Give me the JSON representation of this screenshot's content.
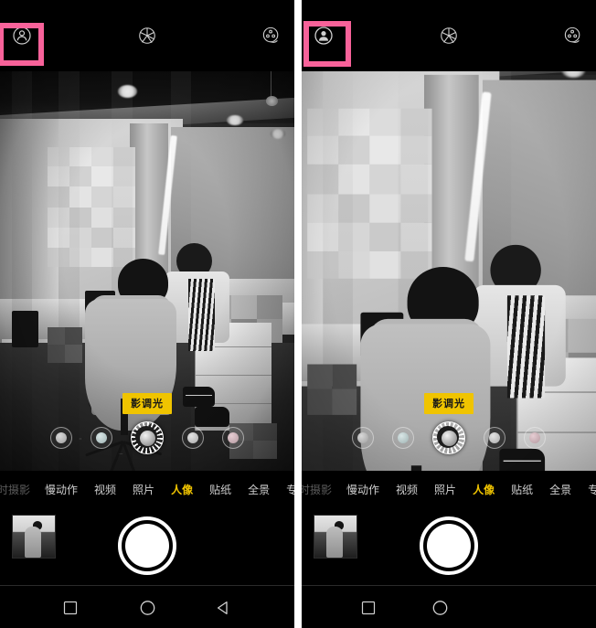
{
  "screenshot": {
    "title": "Camera app portrait-mode comparison",
    "panel_count": 2
  },
  "highlight": {
    "color": "#f8629a",
    "target": "beauty-portrait-toggle"
  },
  "topbar": {
    "left_icon": "portrait-person-icon",
    "mid_icon": "aperture-icon",
    "right_icon": "filter-wheel-icon",
    "left_icon_right_panel": "person-filled-icon"
  },
  "viewfinder": {
    "scene_description": "black and white office interior, person seated at desk with sweater on chair back",
    "badge_label": "影调光",
    "lighting_options": [
      {
        "name": "natural-light",
        "color": "#a8a8a8",
        "selected": false
      },
      {
        "name": "studio-light",
        "color": "#b7c6c6",
        "selected": false
      },
      {
        "name": "tonal-light",
        "color": "#c9c9c9",
        "selected": true
      },
      {
        "name": "stage-light",
        "color": "#bdbdbd",
        "selected": false
      },
      {
        "name": "stage-light-mono",
        "color": "#c6aab0",
        "selected": false
      }
    ]
  },
  "modebar": {
    "items": [
      {
        "label": "延时摄影",
        "state": "cut-off"
      },
      {
        "label": "慢动作",
        "state": "normal"
      },
      {
        "label": "视频",
        "state": "normal"
      },
      {
        "label": "照片",
        "state": "normal"
      },
      {
        "label": "人像",
        "state": "active"
      },
      {
        "label": "贴纸",
        "state": "normal"
      },
      {
        "label": "全景",
        "state": "normal"
      },
      {
        "label": "专业",
        "state": "normal"
      }
    ],
    "active_color": "#f0c400"
  },
  "bottombar": {
    "thumbnail": "last-photo-thumbnail",
    "shutter": "shutter-button"
  },
  "navbar": {
    "recent": "recents-square-icon",
    "home": "home-circle-icon",
    "back": "back-triangle-icon"
  }
}
